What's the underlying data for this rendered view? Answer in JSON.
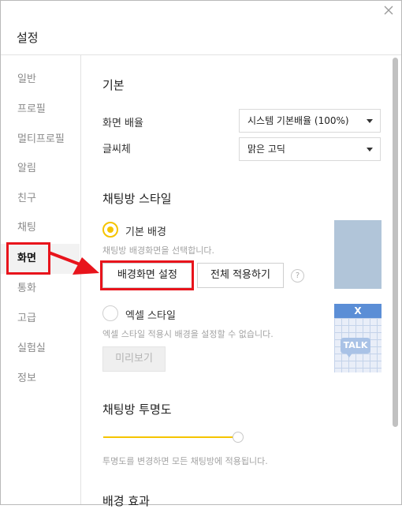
{
  "window": {
    "title": "설정"
  },
  "sidebar": {
    "items": [
      {
        "label": "일반"
      },
      {
        "label": "프로필"
      },
      {
        "label": "멀티프로필"
      },
      {
        "label": "알림"
      },
      {
        "label": "친구"
      },
      {
        "label": "채팅"
      },
      {
        "label": "화면",
        "active": true
      },
      {
        "label": "통화"
      },
      {
        "label": "고급"
      },
      {
        "label": "실험실"
      },
      {
        "label": "정보"
      }
    ]
  },
  "basic": {
    "heading": "기본",
    "screen_scale_label": "화면 배율",
    "screen_scale_value": "시스템 기본배율 (100%)",
    "font_label": "글씨체",
    "font_value": "맑은 고딕"
  },
  "chat_style": {
    "heading": "채팅방 스타일",
    "default_bg_label": "기본 배경",
    "default_bg_selected": true,
    "default_bg_hint": "채팅방 배경화면을 선택합니다.",
    "set_bg_button": "배경화면 설정",
    "apply_all_button": "전체 적용하기",
    "help_glyph": "?",
    "excel_style_label": "엑셀 스타일",
    "excel_style_selected": false,
    "excel_hint": "엑셀 스타일 적용시 배경을 설정할 수 없습니다.",
    "preview_button": "미리보기",
    "excel_thumb_icon": "X",
    "excel_thumb_text": "TALK"
  },
  "transparency": {
    "heading": "채팅방 투명도",
    "level_percent": 100,
    "hint": "투명도를 변경하면 모든 채팅방에 적용됩니다."
  },
  "bg_effect": {
    "heading": "배경 효과"
  },
  "colors": {
    "accent": "#f5c400",
    "annotation_red": "#e8141c"
  }
}
